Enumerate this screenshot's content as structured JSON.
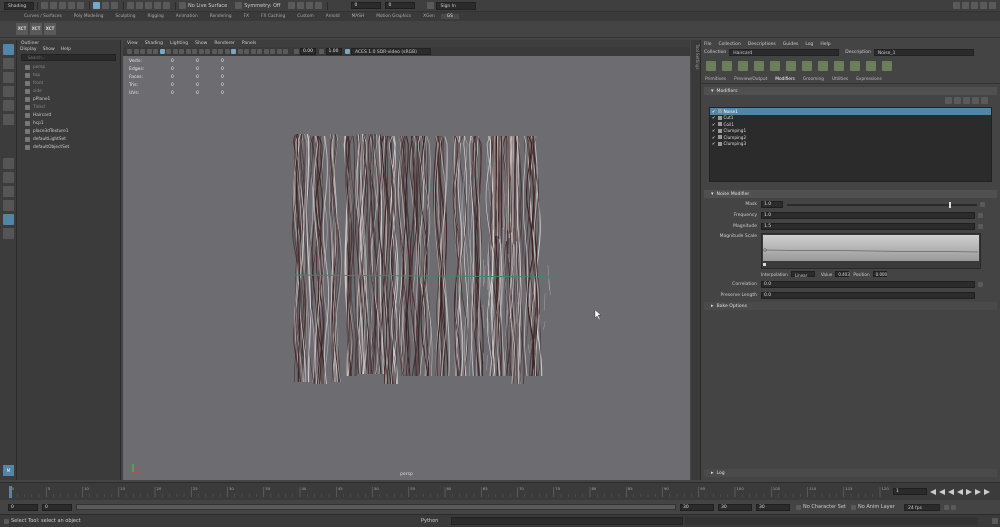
{
  "menubar": {
    "workspace": "Shading",
    "live_surface": "No Live Surface",
    "symmetry": "Symmetry: Off",
    "sign_in": "Sign In",
    "field_value": "0"
  },
  "shelf_tabs": [
    "Curves / Surfaces",
    "Poly Modeling",
    "Sculpting",
    "Rigging",
    "Animation",
    "Rendering",
    "FX",
    "FX Caching",
    "Custom",
    "Arnold",
    "MASH",
    "Motion Graphics",
    "XGen",
    "GS"
  ],
  "shelf_buttons": [
    "XCT",
    "XCT",
    "XCT"
  ],
  "outliner": {
    "title": "Outliner",
    "menu": [
      "Display",
      "Show",
      "Help"
    ],
    "search_placeholder": "Search...",
    "items": [
      {
        "label": "persp",
        "dim": true
      },
      {
        "label": "top",
        "dim": true
      },
      {
        "label": "front",
        "dim": true
      },
      {
        "label": "side",
        "dim": true
      },
      {
        "label": "pPlane1",
        "dim": false
      },
      {
        "label": "Tinkcl",
        "dim": true
      },
      {
        "label": "Haircard",
        "dim": false
      },
      {
        "label": "hcp1",
        "dim": false
      },
      {
        "label": "place3dTexture1",
        "dim": false
      },
      {
        "label": "defaultLightSet",
        "dim": false
      },
      {
        "label": "defaultObjectSet",
        "dim": false
      }
    ]
  },
  "viewport": {
    "menu": [
      "View",
      "Shading",
      "Lighting",
      "Show",
      "Renderer",
      "Panels"
    ],
    "near": "0.00",
    "far": "1.00",
    "color_space": "ACES 1.0 SDR-video (sRGB)",
    "hud": [
      {
        "label": "Verts:",
        "a": "0",
        "b": "0",
        "c": "0"
      },
      {
        "label": "Edges:",
        "a": "0",
        "b": "0",
        "c": "0"
      },
      {
        "label": "Faces:",
        "a": "0",
        "b": "0",
        "c": "0"
      },
      {
        "label": "Tris:",
        "a": "0",
        "b": "0",
        "c": "0"
      },
      {
        "label": "UVs:",
        "a": "0",
        "b": "0",
        "c": "0"
      }
    ],
    "camera": "persp"
  },
  "attribute_editor": {
    "side_label": "Tool Settings",
    "menu": [
      "File",
      "Collection",
      "Descriptions",
      "Guides",
      "Log",
      "Help"
    ],
    "collection_label": "Collection",
    "collection_value": "Haircard",
    "description_label": "Description",
    "description_value": "Noise_1",
    "subtabs": [
      {
        "label": "Primitives",
        "on": false
      },
      {
        "label": "Preview/Output",
        "on": false
      },
      {
        "label": "Modifiers",
        "on": true
      },
      {
        "label": "Grooming",
        "on": false
      },
      {
        "label": "Utilities",
        "on": false
      },
      {
        "label": "Expressions",
        "on": false
      }
    ],
    "modifiers_header": "Modifiers",
    "modifiers": [
      {
        "label": "Noise1",
        "selected": true
      },
      {
        "label": "Cut1",
        "selected": false
      },
      {
        "label": "Coil1",
        "selected": false
      },
      {
        "label": "Clumping1",
        "selected": false
      },
      {
        "label": "Clumping2",
        "selected": false
      },
      {
        "label": "Clumping3",
        "selected": false
      }
    ],
    "noise_header": "Noise Modifier",
    "attrs": [
      {
        "label": "Mask",
        "value": "1.0",
        "level": 0.85
      },
      {
        "label": "Frequency",
        "value": "1.0"
      },
      {
        "label": "Magnitude",
        "value": "1.5"
      }
    ],
    "magnitude_scale_label": "Magnitude Scale",
    "interpolation_label": "Interpolation",
    "interpolation_value": "Linear",
    "value_label": "Value",
    "value_value": "0.403",
    "position_label": "Position",
    "position_value": "0.000",
    "correlation_label": "Correlation",
    "correlation_value": "0.0",
    "preserve_label": "Preserve Length",
    "preserve_value": "0.0",
    "bake_header": "Bake Options",
    "log_header": "Log"
  },
  "timeline": {
    "ticks": [
      "0",
      "5",
      "10",
      "15",
      "20",
      "25",
      "30",
      "35",
      "40",
      "45",
      "50",
      "55",
      "60",
      "65",
      "70",
      "75",
      "80",
      "85",
      "90",
      "95",
      "100",
      "105",
      "110",
      "115",
      "120"
    ],
    "current": "1"
  },
  "range": {
    "start": "0",
    "inner_start": "0",
    "inner_end": "30",
    "end": "30",
    "total": "30",
    "character_set": "No Character Set",
    "anim_layer": "No Anim Layer",
    "fps": "24 fps"
  },
  "status": {
    "message": "Select Tool: select an object",
    "language": "Python"
  },
  "colors": {
    "viewport_bg": "#6d6c71",
    "selection_blue": "#5285a6",
    "hair_dark": "#3b2020",
    "hair_light": "#d8d0d0"
  }
}
